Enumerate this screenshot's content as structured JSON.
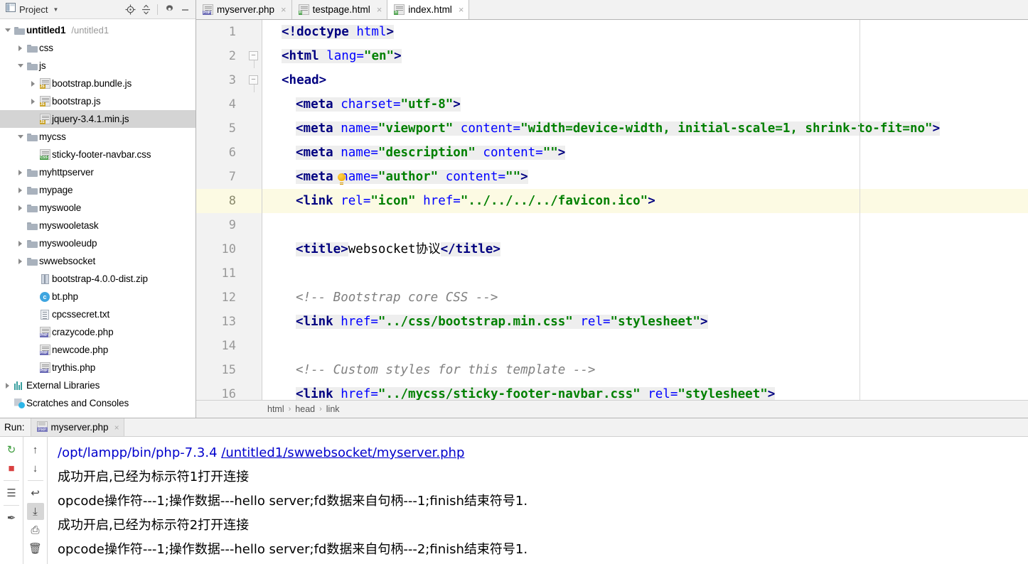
{
  "project_panel": {
    "title": "Project",
    "caret_icon": "chevron-down-icon",
    "icons": [
      {
        "name": "locate-target-icon",
        "label": "Select Opened File"
      },
      {
        "name": "collapse-all-icon",
        "label": "Collapse All"
      },
      {
        "name": "gear-icon",
        "label": "Settings"
      },
      {
        "name": "minimize-icon",
        "label": "Hide"
      }
    ],
    "tree": [
      {
        "label": "untitled1",
        "path": "/untitled1",
        "icon": "folder-icon",
        "indent": 0,
        "arrow": "open",
        "bold": true,
        "selected": false
      },
      {
        "label": "css",
        "path": "",
        "icon": "folder-icon",
        "indent": 1,
        "arrow": "closed",
        "bold": false,
        "selected": false
      },
      {
        "label": "js",
        "path": "",
        "icon": "folder-icon",
        "indent": 1,
        "arrow": "open",
        "bold": false,
        "selected": false
      },
      {
        "label": "bootstrap.bundle.js",
        "path": "",
        "icon": "js-file-icon",
        "indent": 2,
        "arrow": "closed",
        "bold": false,
        "selected": false
      },
      {
        "label": "bootstrap.js",
        "path": "",
        "icon": "js-file-icon",
        "indent": 2,
        "arrow": "closed",
        "bold": false,
        "selected": false
      },
      {
        "label": "jquery-3.4.1.min.js",
        "path": "",
        "icon": "js-file-icon",
        "indent": 2,
        "arrow": "none",
        "bold": false,
        "selected": true
      },
      {
        "label": "mycss",
        "path": "",
        "icon": "folder-icon",
        "indent": 1,
        "arrow": "open",
        "bold": false,
        "selected": false
      },
      {
        "label": "sticky-footer-navbar.css",
        "path": "",
        "icon": "css-file-icon",
        "indent": 2,
        "arrow": "none",
        "bold": false,
        "selected": false
      },
      {
        "label": "myhttpserver",
        "path": "",
        "icon": "folder-icon",
        "indent": 1,
        "arrow": "closed",
        "bold": false,
        "selected": false
      },
      {
        "label": "mypage",
        "path": "",
        "icon": "folder-icon",
        "indent": 1,
        "arrow": "closed",
        "bold": false,
        "selected": false
      },
      {
        "label": "myswoole",
        "path": "",
        "icon": "folder-icon",
        "indent": 1,
        "arrow": "closed",
        "bold": false,
        "selected": false
      },
      {
        "label": "myswooletask",
        "path": "",
        "icon": "folder-icon",
        "indent": 1,
        "arrow": "none",
        "bold": false,
        "selected": false
      },
      {
        "label": "myswooleudp",
        "path": "",
        "icon": "folder-icon",
        "indent": 1,
        "arrow": "closed",
        "bold": false,
        "selected": false
      },
      {
        "label": "swwebsocket",
        "path": "",
        "icon": "folder-icon",
        "indent": 1,
        "arrow": "closed",
        "bold": false,
        "selected": false
      },
      {
        "label": "bootstrap-4.0.0-dist.zip",
        "path": "",
        "icon": "zip-file-icon",
        "indent": 2,
        "arrow": "none",
        "bold": false,
        "selected": false
      },
      {
        "label": "bt.php",
        "path": "",
        "icon": "class-file-icon",
        "indent": 2,
        "arrow": "none",
        "bold": false,
        "selected": false
      },
      {
        "label": "cpcssecret.txt",
        "path": "",
        "icon": "text-file-icon",
        "indent": 2,
        "arrow": "none",
        "bold": false,
        "selected": false
      },
      {
        "label": "crazycode.php",
        "path": "",
        "icon": "php-file-icon",
        "indent": 2,
        "arrow": "none",
        "bold": false,
        "selected": false
      },
      {
        "label": "newcode.php",
        "path": "",
        "icon": "php-file-icon",
        "indent": 2,
        "arrow": "none",
        "bold": false,
        "selected": false
      },
      {
        "label": "trythis.php",
        "path": "",
        "icon": "php-file-icon",
        "indent": 2,
        "arrow": "none",
        "bold": false,
        "selected": false
      },
      {
        "label": "External Libraries",
        "path": "",
        "icon": "library-icon",
        "indent": 0,
        "arrow": "closed",
        "bold": false,
        "selected": false
      },
      {
        "label": "Scratches and Consoles",
        "path": "",
        "icon": "scratches-icon",
        "indent": 0,
        "arrow": "none",
        "bold": false,
        "selected": false
      }
    ]
  },
  "editor": {
    "tabs": [
      {
        "label": "myserver.php",
        "icon": "php-file-icon",
        "active": false
      },
      {
        "label": "testpage.html",
        "icon": "html-file-icon",
        "active": false
      },
      {
        "label": "index.html",
        "icon": "html-file-icon",
        "active": true
      }
    ],
    "close_glyph": "×",
    "current_line": 8,
    "lines": [
      {
        "num": "1",
        "fold": "none",
        "bulb": false,
        "tokens": [
          {
            "t": "<!doctype ",
            "c": "tag",
            "hl": true
          },
          {
            "t": "html",
            "c": "attr",
            "hl": true
          },
          {
            "t": ">",
            "c": "tag",
            "hl": true
          }
        ]
      },
      {
        "num": "2",
        "fold": "start",
        "bulb": false,
        "tokens": [
          {
            "t": "<html ",
            "c": "tag",
            "hl": true
          },
          {
            "t": "lang=",
            "c": "attr",
            "hl": true
          },
          {
            "t": "\"en\"",
            "c": "str",
            "hl": true
          },
          {
            "t": ">",
            "c": "tag",
            "hl": true
          }
        ]
      },
      {
        "num": "3",
        "fold": "start",
        "bulb": false,
        "tokens": [
          {
            "t": "<head>",
            "c": "tag",
            "hl": false
          }
        ]
      },
      {
        "num": "4",
        "fold": "none",
        "bulb": false,
        "indent": 2,
        "tokens": [
          {
            "t": "<meta ",
            "c": "tag",
            "hl": true
          },
          {
            "t": "charset=",
            "c": "attr",
            "hl": true
          },
          {
            "t": "\"utf-8\"",
            "c": "str",
            "hl": true
          },
          {
            "t": ">",
            "c": "tag",
            "hl": true
          }
        ]
      },
      {
        "num": "5",
        "fold": "none",
        "bulb": false,
        "indent": 2,
        "tokens": [
          {
            "t": "<meta ",
            "c": "tag",
            "hl": true
          },
          {
            "t": "name=",
            "c": "attr",
            "hl": true
          },
          {
            "t": "\"viewport\"",
            "c": "str",
            "hl": true
          },
          {
            "t": " content=",
            "c": "attr",
            "hl": true
          },
          {
            "t": "\"width=device-width, initial-scale=1, shrink-to-fit=no\"",
            "c": "str",
            "hl": true
          },
          {
            "t": ">",
            "c": "tag",
            "hl": true
          }
        ]
      },
      {
        "num": "6",
        "fold": "none",
        "bulb": false,
        "indent": 2,
        "tokens": [
          {
            "t": "<meta ",
            "c": "tag",
            "hl": true
          },
          {
            "t": "name=",
            "c": "attr",
            "hl": true
          },
          {
            "t": "\"description\"",
            "c": "str",
            "hl": true
          },
          {
            "t": " content=",
            "c": "attr",
            "hl": true
          },
          {
            "t": "\"\"",
            "c": "str",
            "hl": true
          },
          {
            "t": ">",
            "c": "tag",
            "hl": true
          }
        ]
      },
      {
        "num": "7",
        "fold": "none",
        "bulb": true,
        "indent": 2,
        "tokens": [
          {
            "t": "<meta ",
            "c": "tag",
            "hl": true
          },
          {
            "t": "name=",
            "c": "attr",
            "hl": true
          },
          {
            "t": "\"author\"",
            "c": "str",
            "hl": true
          },
          {
            "t": " content=",
            "c": "attr",
            "hl": true
          },
          {
            "t": "\"\"",
            "c": "str",
            "hl": true
          },
          {
            "t": ">",
            "c": "tag",
            "hl": true
          }
        ]
      },
      {
        "num": "8",
        "fold": "none",
        "bulb": false,
        "indent": 2,
        "tokens": [
          {
            "t": "<link ",
            "c": "tag",
            "hl": false
          },
          {
            "t": "rel=",
            "c": "attr",
            "hl": false
          },
          {
            "t": "\"icon\"",
            "c": "str",
            "hl": false
          },
          {
            "t": " href=",
            "c": "attr",
            "hl": false
          },
          {
            "t": "\"../../../../favicon.ico\"",
            "c": "str",
            "hl": false
          },
          {
            "t": ">",
            "c": "tag",
            "hl": false
          }
        ]
      },
      {
        "num": "9",
        "fold": "none",
        "bulb": false,
        "tokens": []
      },
      {
        "num": "10",
        "fold": "none",
        "bulb": false,
        "indent": 2,
        "tokens": [
          {
            "t": "<title>",
            "c": "tag",
            "hl": true
          },
          {
            "t": "websocket协议",
            "c": "txtc",
            "hl": false
          },
          {
            "t": "</title>",
            "c": "tag",
            "hl": true
          }
        ]
      },
      {
        "num": "11",
        "fold": "none",
        "bulb": false,
        "tokens": []
      },
      {
        "num": "12",
        "fold": "none",
        "bulb": false,
        "indent": 2,
        "tokens": [
          {
            "t": "<!-- Bootstrap core CSS -->",
            "c": "cmt",
            "hl": false
          }
        ]
      },
      {
        "num": "13",
        "fold": "none",
        "bulb": false,
        "indent": 2,
        "tokens": [
          {
            "t": "<link ",
            "c": "tag",
            "hl": true
          },
          {
            "t": "href=",
            "c": "attr",
            "hl": true
          },
          {
            "t": "\"../css/bootstrap.min.css\"",
            "c": "str",
            "hl": true
          },
          {
            "t": " rel=",
            "c": "attr",
            "hl": true
          },
          {
            "t": "\"stylesheet\"",
            "c": "str",
            "hl": true
          },
          {
            "t": ">",
            "c": "tag",
            "hl": true
          }
        ]
      },
      {
        "num": "14",
        "fold": "none",
        "bulb": false,
        "tokens": []
      },
      {
        "num": "15",
        "fold": "none",
        "bulb": false,
        "indent": 2,
        "tokens": [
          {
            "t": "<!-- Custom styles for this template -->",
            "c": "cmt",
            "hl": false
          }
        ]
      },
      {
        "num": "16",
        "fold": "none",
        "bulb": false,
        "indent": 2,
        "tokens": [
          {
            "t": "<link ",
            "c": "tag",
            "hl": true
          },
          {
            "t": "href=",
            "c": "attr",
            "hl": true
          },
          {
            "t": "\"../mycss/sticky-footer-navbar.css\"",
            "c": "str",
            "hl": true
          },
          {
            "t": " rel=",
            "c": "attr",
            "hl": true
          },
          {
            "t": "\"stylesheet\"",
            "c": "str",
            "hl": true
          },
          {
            "t": ">",
            "c": "tag",
            "hl": true
          }
        ]
      }
    ],
    "breadcrumb": [
      "html",
      "head",
      "link"
    ],
    "breadcrumb_sep": "›"
  },
  "run_panel": {
    "label": "Run:",
    "tab": {
      "label": "myserver.php",
      "icon": "php-file-icon"
    },
    "close_glyph": "×",
    "toolbar_left": [
      {
        "name": "rerun-icon",
        "glyph": "↻",
        "color": "#3a9b3a",
        "selected": false
      },
      {
        "name": "stop-icon",
        "glyph": "■",
        "color": "#d94040",
        "selected": false
      },
      {
        "name": "console-icon",
        "glyph": "☰",
        "color": "#555555",
        "selected": false
      },
      {
        "name": "pin-icon",
        "glyph": "✒",
        "color": "#555555",
        "selected": false
      }
    ],
    "toolbar_right": [
      {
        "name": "arrow-up-icon",
        "glyph": "↑",
        "color": "#444444",
        "selected": false
      },
      {
        "name": "arrow-down-icon",
        "glyph": "↓",
        "color": "#444444",
        "selected": false
      },
      {
        "name": "soft-wrap-icon",
        "glyph": "↩",
        "color": "#444444",
        "selected": false
      },
      {
        "name": "scroll-to-end-icon",
        "glyph": "⤓",
        "color": "#444444",
        "selected": true
      },
      {
        "name": "print-icon",
        "glyph": "⎙",
        "color": "#444444",
        "selected": false
      },
      {
        "name": "trash-icon",
        "glyph": "🗑",
        "color": "#444444",
        "selected": false
      }
    ],
    "console_lines": [
      {
        "type": "command",
        "prefix": "/opt/lampp/bin/php-7.3.4 ",
        "link": "/untitled1/swwebsocket/myserver.php"
      },
      {
        "type": "text",
        "text": "成功开启,已经为标示符1打开连接"
      },
      {
        "type": "text",
        "text": "opcode操作符---1;操作数据---hello server;fd数据来自句柄---1;finish结束符号1."
      },
      {
        "type": "text",
        "text": "成功开启,已经为标示符2打开连接"
      },
      {
        "type": "text",
        "text": "opcode操作符---1;操作数据---hello server;fd数据来自句柄---2;finish结束符号1."
      }
    ]
  },
  "colors": {
    "tag": "#000080",
    "attribute": "#0000ff",
    "string": "#008000",
    "comment": "#808080",
    "current_line_bg": "#fcfae3",
    "selection_bg": "#d4d4d4",
    "link": "#0000cc"
  }
}
